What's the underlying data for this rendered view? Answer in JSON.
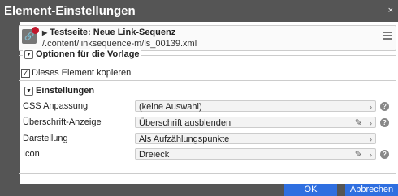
{
  "dialog": {
    "title": "Element-Einstellungen",
    "close_label": "×"
  },
  "resource": {
    "icon": "link-icon",
    "title": "Testseite: Neue Link-Sequenz",
    "path": "/.content/linksequence-m/ls_00139.xml",
    "menu_icon": "hamburger-menu-icon"
  },
  "template_options": {
    "legend": "Optionen für die Vorlage",
    "copy_element_label": "Dieses Element kopieren",
    "copy_element_checked": true
  },
  "settings": {
    "legend": "Einstellungen",
    "rows": [
      {
        "label": "CSS Anpassung",
        "value": "(keine Auswahl)",
        "editable": false,
        "help": true
      },
      {
        "label": "Überschrift-Anzeige",
        "value": "Überschrift ausblenden",
        "editable": true,
        "help": true
      },
      {
        "label": "Darstellung",
        "value": "Als Aufzählungspunkte",
        "editable": false,
        "help": false
      },
      {
        "label": "Icon",
        "value": "Dreieck",
        "editable": true,
        "help": true
      }
    ]
  },
  "footer": {
    "ok_label": "OK",
    "cancel_label": "Abbrechen"
  },
  "colors": {
    "titlebar": "#555555",
    "primary_button": "#2f6fe0",
    "resource_badge": "#c0182d"
  }
}
